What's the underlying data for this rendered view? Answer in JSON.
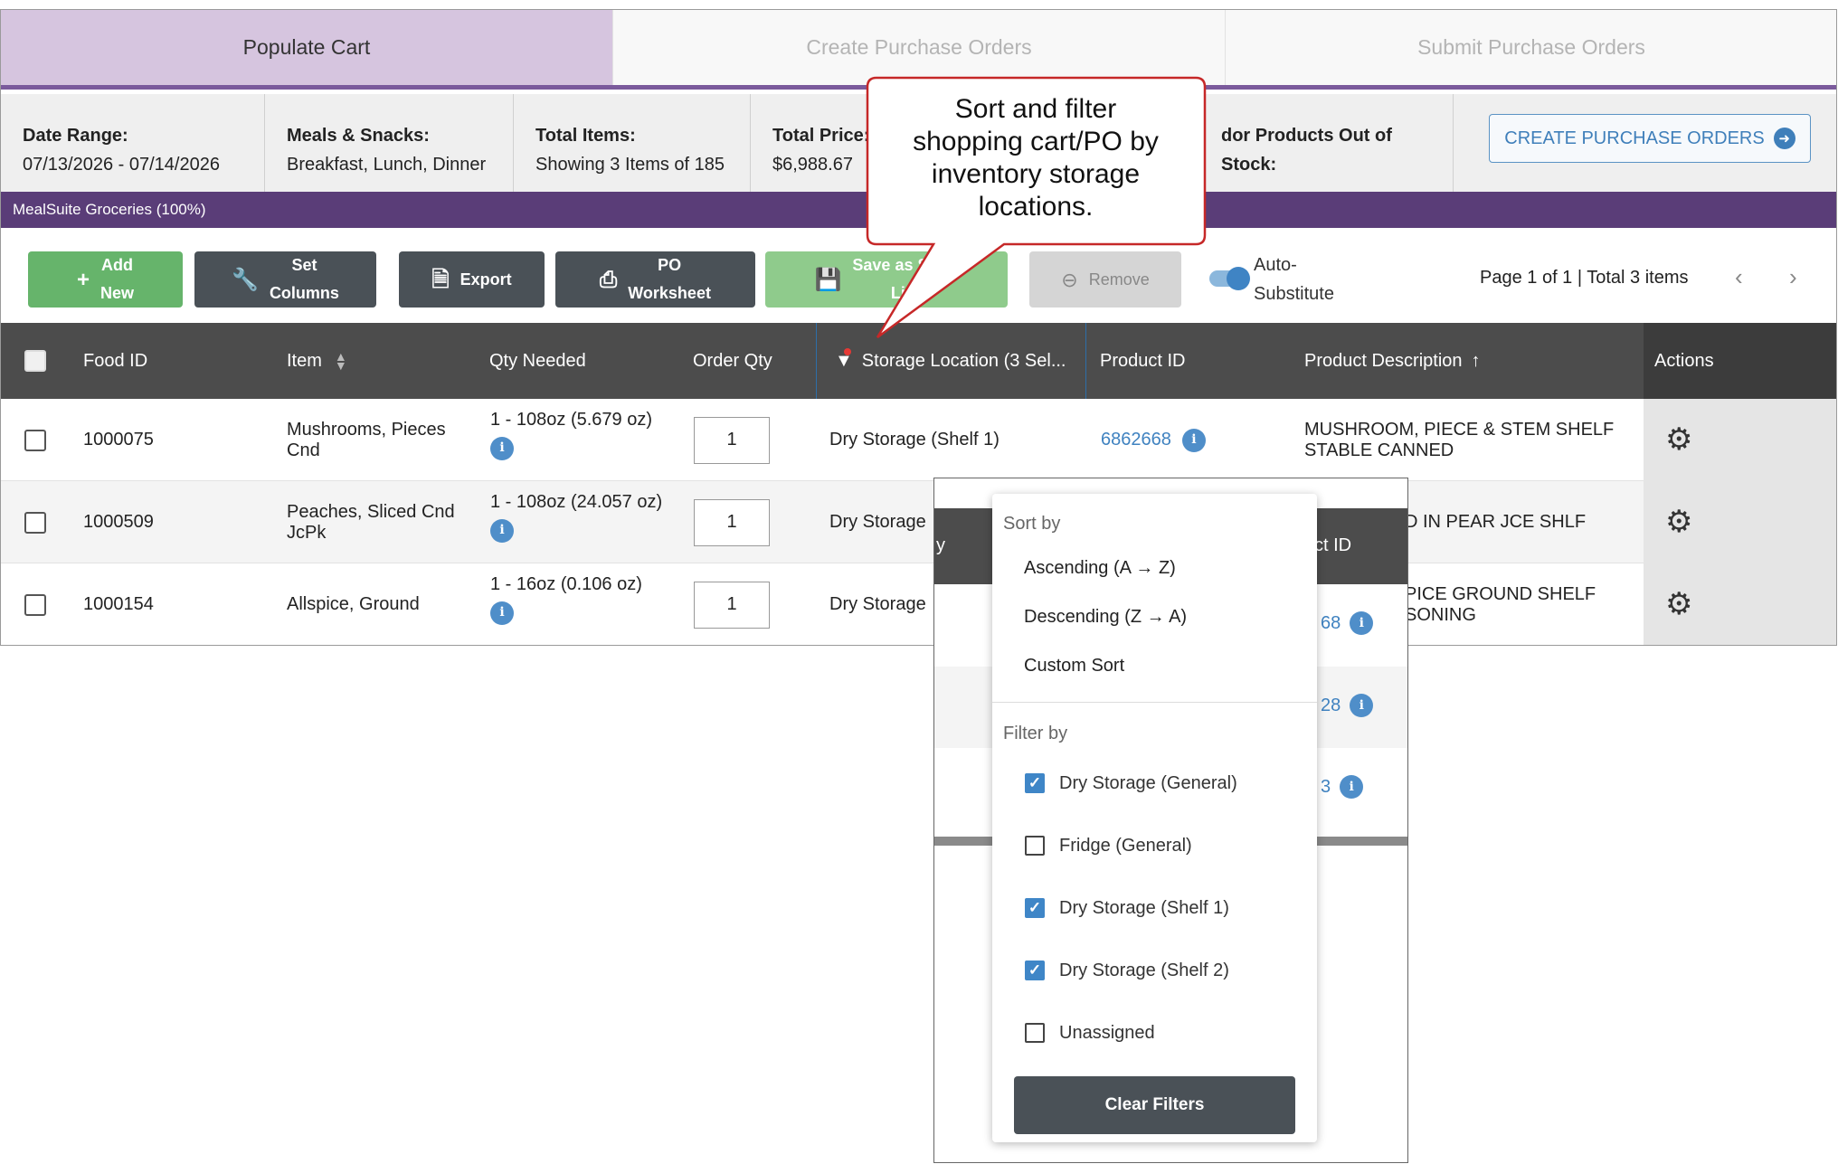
{
  "steps": [
    "Populate Cart",
    "Create Purchase Orders",
    "Submit Purchase Orders"
  ],
  "summary": {
    "date_range_label": "Date Range:",
    "date_range_value": "07/13/2026 - 07/14/2026",
    "meals_label": "Meals & Snacks:",
    "meals_value": "Breakfast, Lunch, Dinner",
    "total_items_label": "Total Items:",
    "total_items_value": "Showing 3 Items of 185",
    "total_price_label": "Total Price:",
    "total_price_value": "$6,988.67",
    "vendor_oos_label": "dor Products Out of Stock:"
  },
  "create_po_button": "CREATE PURCHASE ORDERS",
  "vendor_bar": "MealSuite Groceries (100%)",
  "toolbar": {
    "add_new": [
      "Add",
      "New"
    ],
    "set_columns": [
      "Set",
      "Columns"
    ],
    "export": "Export",
    "po_worksheet": [
      "PO",
      "Worksheet"
    ],
    "save_list": [
      "Save as Shop",
      "List"
    ],
    "remove": "Remove",
    "auto_substitute": [
      "Auto-",
      "Substitute"
    ],
    "page_info": "Page 1 of 1 | Total 3 items"
  },
  "columns": {
    "food_id": "Food ID",
    "item": "Item",
    "qty_needed": "Qty Needed",
    "order_qty": "Order Qty",
    "storage_location": "Storage Location (3 Sel...",
    "product_id": "Product ID",
    "product_description": "Product Description",
    "actions": "Actions"
  },
  "rows": [
    {
      "food_id": "1000075",
      "item": [
        "Mushrooms, Pieces",
        "Cnd"
      ],
      "qty_needed": "1 - 108oz (5.679 oz)",
      "order_qty": "1",
      "storage": "Dry Storage (Shelf 1)",
      "product_id": "6862668",
      "description": [
        "MUSHROOM, PIECE & STEM SHELF",
        "STABLE CANNED"
      ]
    },
    {
      "food_id": "1000509",
      "item": [
        "Peaches, Sliced Cnd",
        "JcPk"
      ],
      "qty_needed": "1 - 108oz (24.057 oz)",
      "order_qty": "1",
      "storage": "Dry Storage",
      "product_id": "",
      "description": [
        "D IN PEAR JCE SHLF"
      ]
    },
    {
      "food_id": "1000154",
      "item": [
        "Allspice, Ground"
      ],
      "qty_needed": "1 - 16oz (0.106 oz)",
      "order_qty": "1",
      "storage": "Dry Storage",
      "product_id": "",
      "description": [
        "PICE GROUND SHELF",
        "SONING"
      ]
    }
  ],
  "ghost": {
    "col_left": "y",
    "col_right": "ct ID",
    "ids": [
      "68",
      "28",
      "3"
    ]
  },
  "menu": {
    "sort_by": "Sort by",
    "sort_options": [
      "Ascending (A → Z)",
      "Descending (Z → A)",
      "Custom Sort"
    ],
    "filter_by": "Filter by",
    "filters": [
      {
        "label": "Dry Storage (General)",
        "checked": true
      },
      {
        "label": "Fridge (General)",
        "checked": false
      },
      {
        "label": "Dry Storage (Shelf 1)",
        "checked": true
      },
      {
        "label": "Dry Storage (Shelf 2)",
        "checked": true
      },
      {
        "label": "Unassigned",
        "checked": false
      }
    ],
    "clear_filters": "Clear Filters"
  },
  "callout": [
    "Sort and filter",
    "shopping cart/PO by",
    "inventory storage",
    "locations."
  ],
  "colors": {
    "accent_purple": "#5a3d78",
    "active_step": "#d6c5df",
    "link_blue": "#3f82c0",
    "green": "#66b46b"
  }
}
